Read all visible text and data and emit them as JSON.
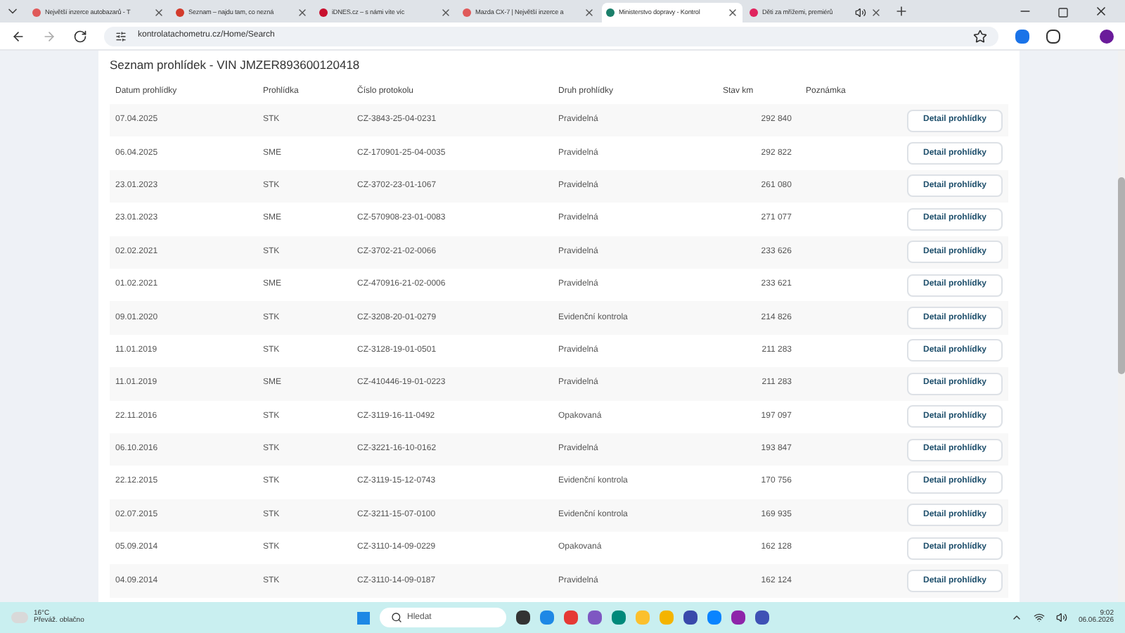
{
  "browser": {
    "tabs": [
      {
        "title": "Největší inzerce autobazarů - T",
        "selected": false,
        "color": "#e05a5a"
      },
      {
        "title": "Seznam – najdu tam, co nezná",
        "selected": false,
        "color": "#d33b2c"
      },
      {
        "title": "iDNES.cz – s námi víte víc",
        "selected": false,
        "color": "#c8102e"
      },
      {
        "title": "Mazda CX-7 | Největší inzerce a",
        "selected": false,
        "color": "#e05a5a"
      },
      {
        "title": "Ministerstvo dopravy - Kontrol",
        "selected": true,
        "color": "#1b7f6a"
      },
      {
        "title": "Děti za mřížemi, premiérů",
        "selected": false,
        "color": "#e0245e",
        "audio": true
      }
    ],
    "address": "kontrolatachometru.cz/Home/Search"
  },
  "page": {
    "title": "Seznam prohlídek - VIN JMZER893600120418",
    "columns": [
      "Datum prohlídky",
      "Prohlídka",
      "Číslo protokolu",
      "Druh prohlídky",
      "Stav km",
      "Poznámka"
    ],
    "rows": [
      {
        "date": "07.04.2025",
        "type": "STK",
        "protocol": "CZ-3843-25-04-0231",
        "kind": "Pravidelná",
        "km": "292 840",
        "action": "Detail prohlídky"
      },
      {
        "date": "06.04.2025",
        "type": "SME",
        "protocol": "CZ-170901-25-04-0035",
        "kind": "Pravidelná",
        "km": "292 822",
        "action": "Detail prohlídky"
      },
      {
        "date": "23.01.2023",
        "type": "STK",
        "protocol": "CZ-3702-23-01-1067",
        "kind": "Pravidelná",
        "km": "261 080",
        "action": "Detail prohlídky"
      },
      {
        "date": "23.01.2023",
        "type": "SME",
        "protocol": "CZ-570908-23-01-0083",
        "kind": "Pravidelná",
        "km": "271 077",
        "action": "Detail prohlídky"
      },
      {
        "date": "02.02.2021",
        "type": "STK",
        "protocol": "CZ-3702-21-02-0066",
        "kind": "Pravidelná",
        "km": "233 626",
        "action": "Detail prohlídky"
      },
      {
        "date": "01.02.2021",
        "type": "SME",
        "protocol": "CZ-470916-21-02-0006",
        "kind": "Pravidelná",
        "km": "233 621",
        "action": "Detail prohlídky"
      },
      {
        "date": "09.01.2020",
        "type": "STK",
        "protocol": "CZ-3208-20-01-0279",
        "kind": "Evidenční kontrola",
        "km": "214 826",
        "action": "Detail prohlídky"
      },
      {
        "date": "11.01.2019",
        "type": "STK",
        "protocol": "CZ-3128-19-01-0501",
        "kind": "Pravidelná",
        "km": "211 283",
        "action": "Detail prohlídky"
      },
      {
        "date": "11.01.2019",
        "type": "SME",
        "protocol": "CZ-410446-19-01-0223",
        "kind": "Pravidelná",
        "km": "211 283",
        "action": "Detail prohlídky"
      },
      {
        "date": "22.11.2016",
        "type": "STK",
        "protocol": "CZ-3119-16-11-0492",
        "kind": "Opakovaná",
        "km": "197 097",
        "action": "Detail prohlídky"
      },
      {
        "date": "06.10.2016",
        "type": "STK",
        "protocol": "CZ-3221-16-10-0162",
        "kind": "Pravidelná",
        "km": "193 847",
        "action": "Detail prohlídky"
      },
      {
        "date": "22.12.2015",
        "type": "STK",
        "protocol": "CZ-3119-15-12-0743",
        "kind": "Evidenční kontrola",
        "km": "170 756",
        "action": "Detail prohlídky"
      },
      {
        "date": "02.07.2015",
        "type": "STK",
        "protocol": "CZ-3211-15-07-0100",
        "kind": "Evidenční kontrola",
        "km": "169 935",
        "action": "Detail prohlídky"
      },
      {
        "date": "05.09.2014",
        "type": "STK",
        "protocol": "CZ-3110-14-09-0229",
        "kind": "Opakovaná",
        "km": "162 128",
        "action": "Detail prohlídky"
      },
      {
        "date": "04.09.2014",
        "type": "STK",
        "protocol": "CZ-3110-14-09-0187",
        "kind": "Pravidelná",
        "km": "162 124",
        "action": "Detail prohlídky"
      }
    ]
  },
  "taskbar": {
    "temperature": "16°C",
    "weather": "Převáž. oblačno",
    "search_placeholder": "Hledat",
    "time": "9:02",
    "date": "06.06.2026"
  }
}
